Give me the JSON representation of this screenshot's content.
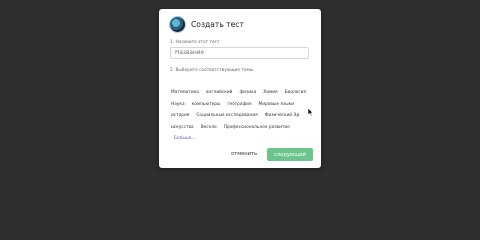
{
  "dialog": {
    "title": "Создать тест",
    "name_label": "1. Назовите этот тест",
    "name_placeholder": "Название",
    "topics_label": "2. Выберите соответствующие темы",
    "topic_rows": [
      [
        "Математика",
        "английский",
        "физика",
        "Химия",
        "Биология"
      ],
      [
        "Наука",
        "компьютеры",
        "география",
        "Мировые языки"
      ],
      [
        "история",
        "Социальные исследования",
        "Физический Эд"
      ],
      [
        "искусства",
        "Весело",
        "Профессиональное развитие"
      ]
    ],
    "more_label": "Больше...",
    "cancel_label": "отменить",
    "next_label": "следующий"
  },
  "colors": {
    "backdrop": "#2e2e2e",
    "next_button": "#6cc58a",
    "more_link": "#5b57c2"
  },
  "icons": {
    "avatar": "quiz-mascot-avatar",
    "cursor": "mouse-pointer-icon"
  }
}
